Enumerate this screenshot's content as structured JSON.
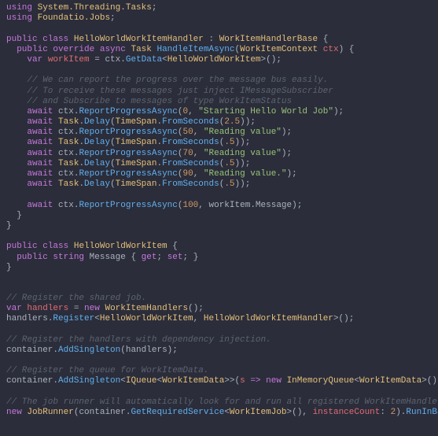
{
  "block1": {
    "l1_using": "using",
    "l1_ns": "System.Threading.Tasks",
    "l2_using": "using",
    "l2_ns": "Foundatio.Jobs",
    "l3_public": "public",
    "l3_class": "class",
    "l3_name": "HelloWorldWorkItemHandler",
    "l3_base": "WorkItemHandlerBase",
    "l4_public": "public",
    "l4_override": "override",
    "l4_async": "async",
    "l4_task": "Task",
    "l4_method": "HandleItemAsync",
    "l4_ptype": "WorkItemContext",
    "l4_pname": "ctx",
    "l5_var": "var",
    "l5_name": "workItem",
    "l5_ctx": "ctx",
    "l5_getdata": "GetData",
    "l5_gtype": "HelloWorldWorkItem",
    "c1": "// We can report the progress over the message bus easily.",
    "c2": "// To receive these messages just inject IMessageSubscriber",
    "c3": "// and Subscribe to messages of type WorkItemStatus",
    "await": "await",
    "ctx": "ctx",
    "rpa": "ReportProgressAsync",
    "task": "Task",
    "delay": "Delay",
    "timespan": "TimeSpan",
    "fromsec": "FromSeconds",
    "p0": "0",
    "p0msg": "\"Starting Hello World Job\"",
    "d1": "2.5",
    "p50": "50",
    "rv": "\"Reading value\"",
    "d5": ".5",
    "p70": "70",
    "p90": "90",
    "rvdot": "\"Reading value.\"",
    "p100": "100",
    "wim": "workItem",
    "msg": "Message",
    "cls2_public": "public",
    "cls2_class": "class",
    "cls2_name": "HelloWorldWorkItem",
    "prop_public": "public",
    "prop_string": "string",
    "prop_name": "Message",
    "prop_get": "get",
    "prop_set": "set"
  },
  "block2": {
    "c1": "// Register the shared job.",
    "var": "var",
    "handlers": "handlers",
    "new": "new",
    "wih": "WorkItemHandlers",
    "reg": "Register",
    "t1": "HelloWorldWorkItem",
    "t2": "HelloWorldWorkItemHandler",
    "c2": "// Register the handlers with dependency injection.",
    "container": "container",
    "addsingleton": "AddSingleton",
    "c3": "// Register the queue for WorkItemData.",
    "iqueue": "IQueue",
    "wid": "WorkItemData",
    "s": "s",
    "arrow": "=>",
    "imq": "InMemoryQueue",
    "c4": "// The job runner will automatically look for and run all registered WorkItemHandlers.",
    "jobrunner": "JobRunner",
    "grs": "GetRequiredService",
    "wij": "WorkItemJob",
    "icount": "instanceCount",
    "two": "2",
    "rib": "RunInBackground"
  }
}
